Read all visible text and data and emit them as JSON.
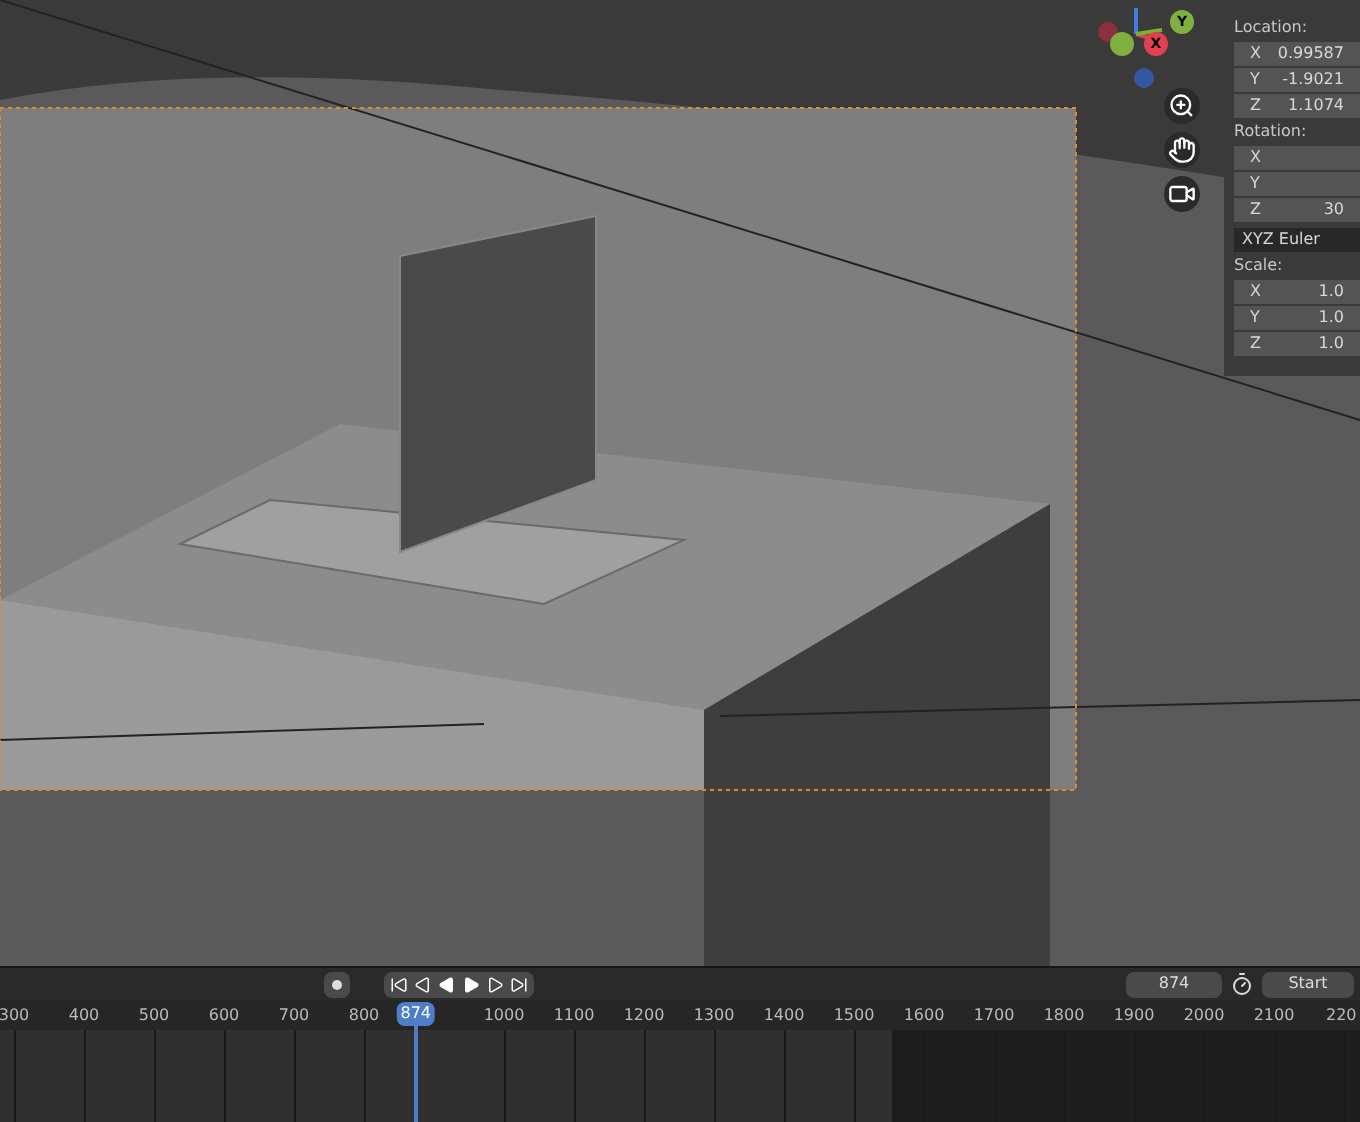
{
  "sidebar": {
    "sections": [
      {
        "title": "Location:",
        "fields": [
          {
            "axis": "X",
            "value": "0.99587"
          },
          {
            "axis": "Y",
            "value": "-1.9021"
          },
          {
            "axis": "Z",
            "value": "1.1074"
          }
        ]
      },
      {
        "title": "Rotation:",
        "fields": [
          {
            "axis": "X"
          },
          {
            "axis": "Y"
          },
          {
            "axis": "Z",
            "value": "30"
          }
        ],
        "mode": "XYZ Euler"
      },
      {
        "title": "Scale:",
        "fields": [
          {
            "axis": "X",
            "value": "1.0"
          },
          {
            "axis": "Y",
            "value": "1.0"
          },
          {
            "axis": "Z",
            "value": "1.0"
          }
        ]
      }
    ]
  },
  "gizmo": {
    "axes": [
      "X",
      "Y"
    ]
  },
  "timeline": {
    "current_frame": "874",
    "start_label": "Start",
    "playhead": "874",
    "ticks": [
      "300",
      "400",
      "500",
      "600",
      "700",
      "800",
      "1000",
      "1100",
      "1200",
      "1300",
      "1400",
      "1500",
      "1600",
      "1700",
      "1800",
      "1900",
      "2000",
      "2100",
      "220"
    ]
  }
}
